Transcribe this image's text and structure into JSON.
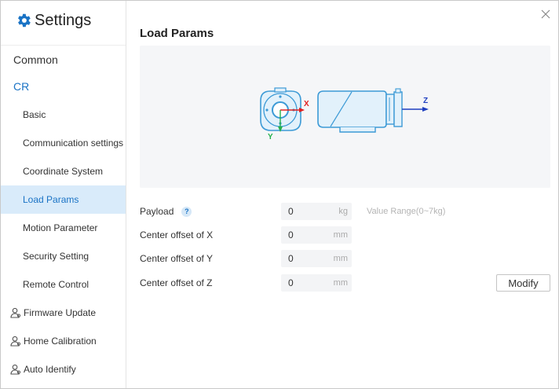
{
  "app": {
    "title": "Settings"
  },
  "sidebar": {
    "common": "Common",
    "cr": "CR",
    "sub_items": [
      {
        "label": "Basic"
      },
      {
        "label": "Communication settings"
      },
      {
        "label": "Coordinate System"
      },
      {
        "label": "Load Params",
        "active": true
      },
      {
        "label": "Motion Parameter"
      },
      {
        "label": "Security Setting"
      },
      {
        "label": "Remote Control"
      }
    ],
    "user_items": [
      {
        "label": "Firmware Update",
        "icon": "user-icon"
      },
      {
        "label": "Home Calibration",
        "icon": "user-icon"
      },
      {
        "label": "Auto Identify",
        "icon": "user-icon"
      }
    ]
  },
  "main": {
    "title": "Load Params",
    "figure": {
      "axis_x": "X",
      "axis_y": "Y",
      "axis_z": "Z"
    },
    "fields": [
      {
        "label": "Payload",
        "value": "0",
        "unit": "kg",
        "has_help": true,
        "help_icon": "?"
      },
      {
        "label": "Center offset of X",
        "value": "0",
        "unit": "mm"
      },
      {
        "label": "Center offset of Y",
        "value": "0",
        "unit": "mm"
      },
      {
        "label": "Center offset of Z",
        "value": "0",
        "unit": "mm"
      }
    ],
    "range_hint": "Value Range(0~7kg)",
    "modify_label": "Modify"
  },
  "colors": {
    "accent": "#1a73c5",
    "active_bg": "#d9ebfa",
    "axis_x": "#e02020",
    "axis_y": "#23b04b",
    "axis_z": "#1f3fbf",
    "robot_line": "#3c9ad6",
    "robot_fill": "#e2f1fb"
  }
}
